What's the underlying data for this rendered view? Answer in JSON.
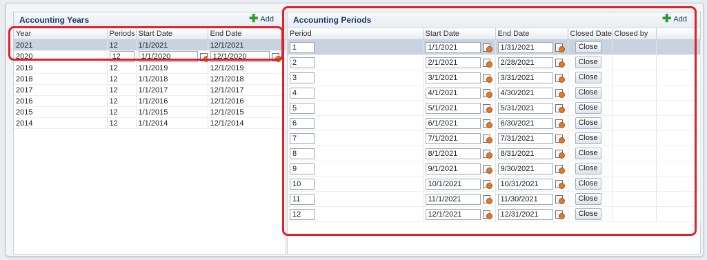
{
  "years_panel": {
    "title": "Accounting Years",
    "add_label": "Add",
    "columns": [
      "Year",
      "Periods",
      "Start Date",
      "End Date"
    ],
    "rows": [
      {
        "year": "2021",
        "periods": "12",
        "start": "1/1/2021",
        "end": "12/1/2021"
      },
      {
        "year": "2020",
        "periods": "12",
        "start": "1/1/2020",
        "end": "12/1/2020"
      },
      {
        "year": "2019",
        "periods": "12",
        "start": "1/1/2019",
        "end": "12/1/2019"
      },
      {
        "year": "2018",
        "periods": "12",
        "start": "1/1/2018",
        "end": "12/1/2018"
      },
      {
        "year": "2017",
        "periods": "12",
        "start": "1/1/2017",
        "end": "12/1/2017"
      },
      {
        "year": "2016",
        "periods": "12",
        "start": "1/1/2016",
        "end": "12/1/2016"
      },
      {
        "year": "2015",
        "periods": "12",
        "start": "1/1/2015",
        "end": "12/1/2015"
      },
      {
        "year": "2014",
        "periods": "12",
        "start": "1/1/2014",
        "end": "12/1/2014"
      }
    ]
  },
  "periods_panel": {
    "title": "Accounting Periods",
    "add_label": "Add",
    "columns": [
      "Period",
      "Start Date",
      "End Date",
      "Closed Date",
      "Closed by"
    ],
    "close_label": "Close",
    "rows": [
      {
        "period": "1",
        "start": "1/1/2021",
        "end": "1/31/2021"
      },
      {
        "period": "2",
        "start": "2/1/2021",
        "end": "2/28/2021"
      },
      {
        "period": "3",
        "start": "3/1/2021",
        "end": "3/31/2021"
      },
      {
        "period": "4",
        "start": "4/1/2021",
        "end": "4/30/2021"
      },
      {
        "period": "5",
        "start": "5/1/2021",
        "end": "5/31/2021"
      },
      {
        "period": "6",
        "start": "6/1/2021",
        "end": "6/30/2021"
      },
      {
        "period": "7",
        "start": "7/1/2021",
        "end": "7/31/2021"
      },
      {
        "period": "8",
        "start": "8/1/2021",
        "end": "8/31/2021"
      },
      {
        "period": "9",
        "start": "9/1/2021",
        "end": "9/30/2021"
      },
      {
        "period": "10",
        "start": "10/1/2021",
        "end": "10/31/2021"
      },
      {
        "period": "11",
        "start": "11/1/2021",
        "end": "11/30/2021"
      },
      {
        "period": "12",
        "start": "12/1/2021",
        "end": "12/31/2021"
      }
    ]
  },
  "colors": {
    "highlight": "#e0202a",
    "selected_row": "#c9d2df",
    "header_text": "#1a3c66",
    "add_icon": "#2a9a2a"
  }
}
